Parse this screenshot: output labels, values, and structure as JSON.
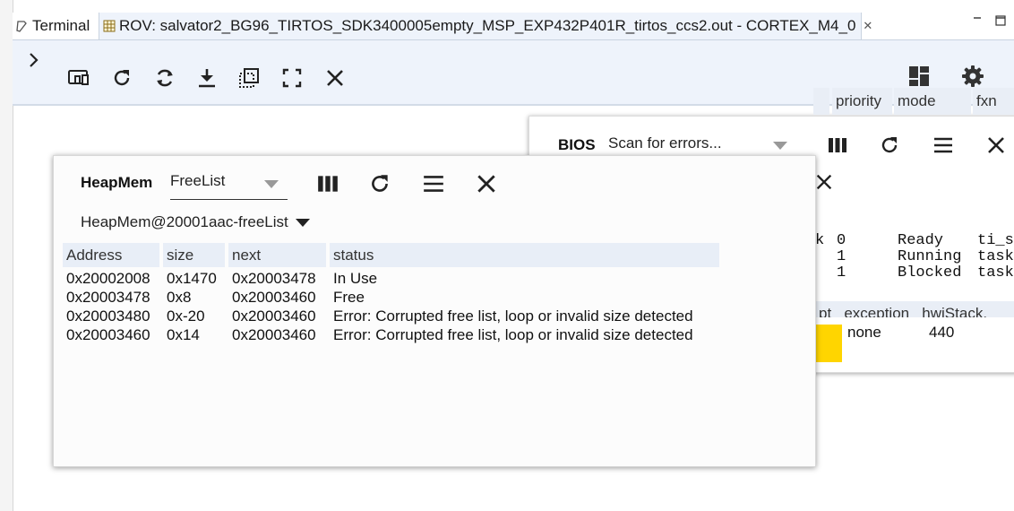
{
  "tabs": [
    {
      "label": "Terminal",
      "icon": "terminal-icon"
    },
    {
      "label": "ROV: salvator2_BG96_TIRTOS_SDK3400005empty_MSP_EXP432P401R_tirtos_ccs2.out - CORTEX_M4_0",
      "icon": "grid-icon"
    }
  ],
  "bios": {
    "title": "BIOS",
    "select_value": "Scan for errors...",
    "task_columns": [
      "priority",
      "mode",
      "fxn"
    ],
    "task_rows": [
      {
        "pre": "k",
        "priority": "0",
        "mode": "Ready",
        "fxn": "ti_s"
      },
      {
        "pre": "",
        "priority": "1",
        "mode": "Running",
        "fxn": "task"
      },
      {
        "pre": "",
        "priority": "1",
        "mode": "Blocked",
        "fxn": "task"
      }
    ],
    "exception_headers": "pt   exception   hwiStack.",
    "exception_value": "none",
    "stack_value": "440"
  },
  "heap": {
    "title": "HeapMem",
    "view_value": "FreeList",
    "instance_value": "HeapMem@20001aac-freeList",
    "columns": [
      "Address",
      "size",
      "next",
      "status"
    ],
    "rows": [
      {
        "address": "0x20002008",
        "size": "0x1470",
        "next": "0x20003478",
        "status": "In Use"
      },
      {
        "address": "0x20003478",
        "size": "0x8",
        "next": "0x20003460",
        "status": "Free"
      },
      {
        "address": "0x20003480",
        "size": "0x-20",
        "next": "0x20003460",
        "status": "Error: Corrupted free list, loop or invalid size detected"
      },
      {
        "address": "0x20003460",
        "size": "0x14",
        "next": "0x20003460",
        "status": "Error: Corrupted free list, loop or invalid size detected"
      }
    ]
  },
  "colors": {
    "accent_band": "#eef3fb",
    "header_band": "#e8eef7",
    "highlight": "#ffd500"
  }
}
